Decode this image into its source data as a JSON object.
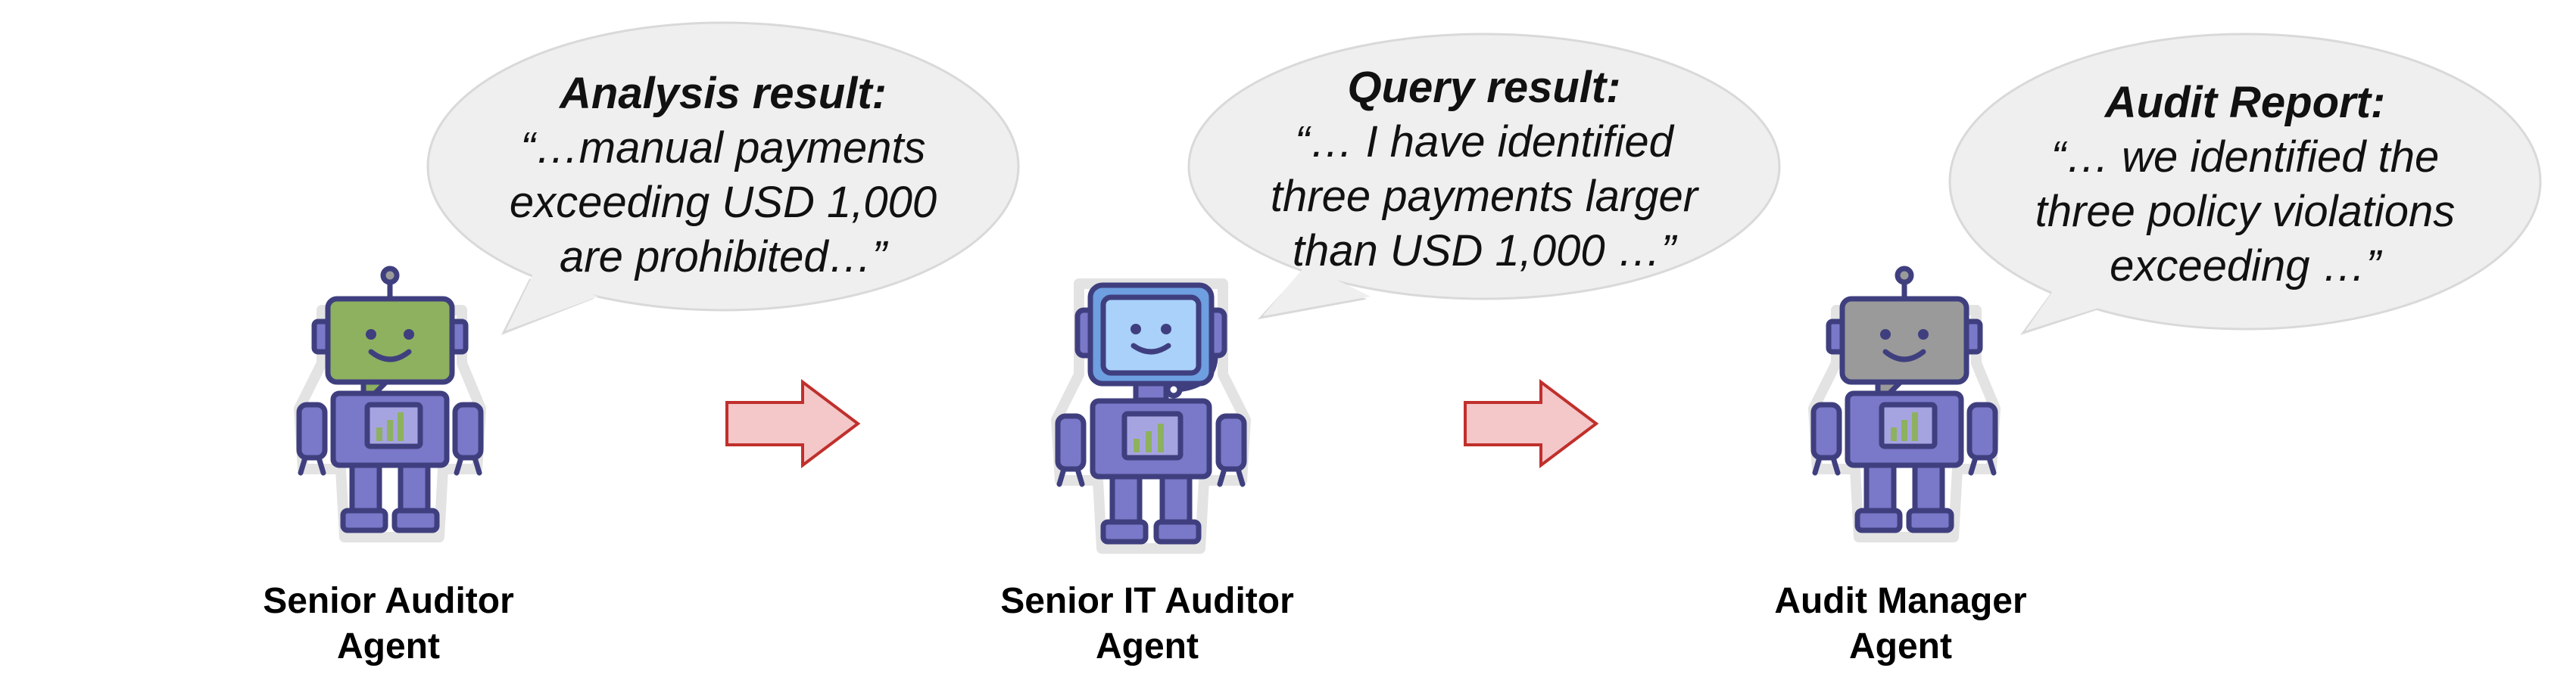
{
  "agents": [
    {
      "label_lines": [
        "Senior Auditor",
        "Agent"
      ],
      "icon": "green-robot-icon",
      "head_color": "#8db15f",
      "bubble": {
        "title": "Analysis result:",
        "lines": [
          "“…manual payments",
          "exceeding USD 1,000",
          "are prohibited…”"
        ]
      }
    },
    {
      "label_lines": [
        "Senior IT Auditor",
        "Agent"
      ],
      "icon": "blue-headset-robot-icon",
      "head_color": "#8fc3f5",
      "bubble": {
        "title": "Query result:",
        "lines": [
          "“… I have identified",
          "three payments larger",
          "than USD 1,000 …”"
        ]
      }
    },
    {
      "label_lines": [
        "Audit Manager",
        "Agent"
      ],
      "icon": "gray-robot-icon",
      "head_color": "#9a9a9a",
      "bubble": {
        "title": "Audit Report:",
        "lines": [
          "“… we identified the",
          "three policy violations",
          "exceeding …”"
        ]
      }
    }
  ],
  "arrows": [
    "right-arrow-icon",
    "right-arrow-icon"
  ],
  "colors": {
    "bubble_fill": "#efefef",
    "bubble_stroke": "#d9d9d9",
    "arrow_fill": "#f4c7c9",
    "arrow_stroke": "#c0302c",
    "robot_body": "#7a78c8",
    "robot_outline": "#3f3f7f"
  }
}
